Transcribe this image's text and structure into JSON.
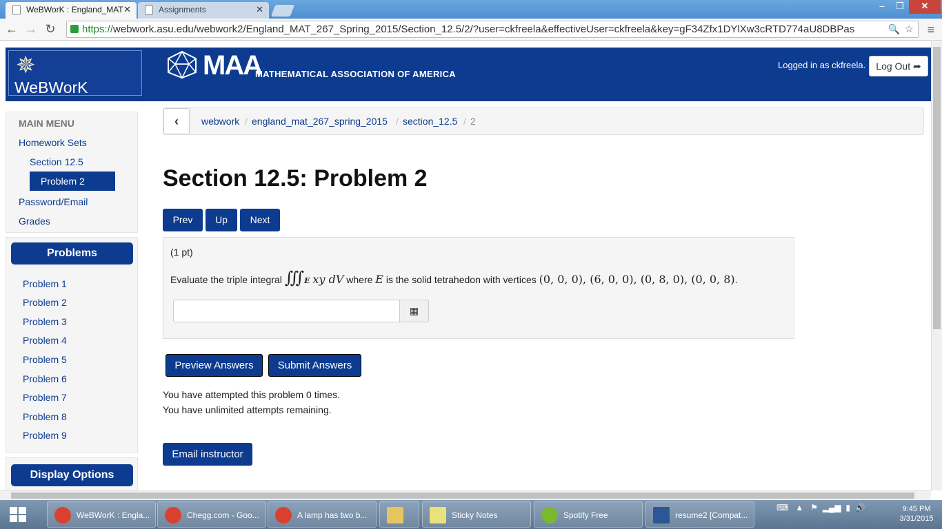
{
  "browser": {
    "tabs": [
      {
        "label": "WeBWorK : England_MAT"
      },
      {
        "label": "Assignments"
      }
    ],
    "window_controls": {
      "minimize": "‒",
      "maximize": "❐",
      "close": "✕"
    },
    "url_scheme": "https://",
    "url_rest": "webwork.asu.edu/webwork2/England_MAT_267_Spring_2015/Section_12.5/2/?user=ckfreela&effectiveUser=ckfreela&key=gF34Zfx1DYlXw3cRTD774aU8DBPas"
  },
  "header": {
    "webwork_logo_text": "WeBWorK",
    "maa_short": "MAA",
    "maa_full": "MATHEMATICAL ASSOCIATION OF AMERICA",
    "logged_in": "Logged in as ckfreela.",
    "logout_label": "Log Out ➦"
  },
  "main_menu": {
    "title": "MAIN MENU",
    "homework_sets": "Homework Sets",
    "section": "Section 12.5",
    "problem": "Problem 2",
    "password_email": "Password/Email",
    "grades": "Grades"
  },
  "problems_panel": {
    "title": "Problems",
    "items": [
      "Problem 1",
      "Problem 2",
      "Problem 3",
      "Problem 4",
      "Problem 5",
      "Problem 6",
      "Problem 7",
      "Problem 8",
      "Problem 9"
    ]
  },
  "display_options": {
    "title": "Display Options"
  },
  "breadcrumb": {
    "items": [
      "webwork",
      "england_mat_267_spring_2015",
      "section_12.5"
    ],
    "current": "2"
  },
  "page_title": "Section 12.5: Problem 2",
  "nav_buttons": {
    "prev": "Prev",
    "up": "Up",
    "next": "Next"
  },
  "problem": {
    "points": "(1 pt)",
    "text_before": "Evaluate the triple integral",
    "integral": "∭",
    "integral_sub": "E",
    "integrand": "xy dV",
    "text_where": "where",
    "var_E": "E",
    "text_after": "is the solid tetrahedon with vertices",
    "vertices": "(0, 0, 0), (6, 0, 0), (0, 8, 0), (0, 0, 8)",
    "period": ".",
    "answer_value": "",
    "equation_editor_icon": "grid-icon"
  },
  "actions": {
    "preview": "Preview Answers",
    "submit": "Submit Answers",
    "attempts": "You have attempted this problem 0 times.",
    "remaining": "You have unlimited attempts remaining.",
    "email": "Email instructor"
  },
  "taskbar": {
    "items": [
      {
        "label": "WeBWorK : Engla..."
      },
      {
        "label": "Chegg.com - Goo..."
      },
      {
        "label": "A lamp has two b..."
      },
      {
        "label": ""
      },
      {
        "label": "Sticky Notes"
      },
      {
        "label": "Spotify Free"
      },
      {
        "label": "resume2 [Compat..."
      }
    ],
    "time": "9:45 PM",
    "date": "3/31/2015"
  },
  "colors": {
    "brand_blue": "#0c3b8f",
    "link_blue": "#0d3b8d"
  }
}
